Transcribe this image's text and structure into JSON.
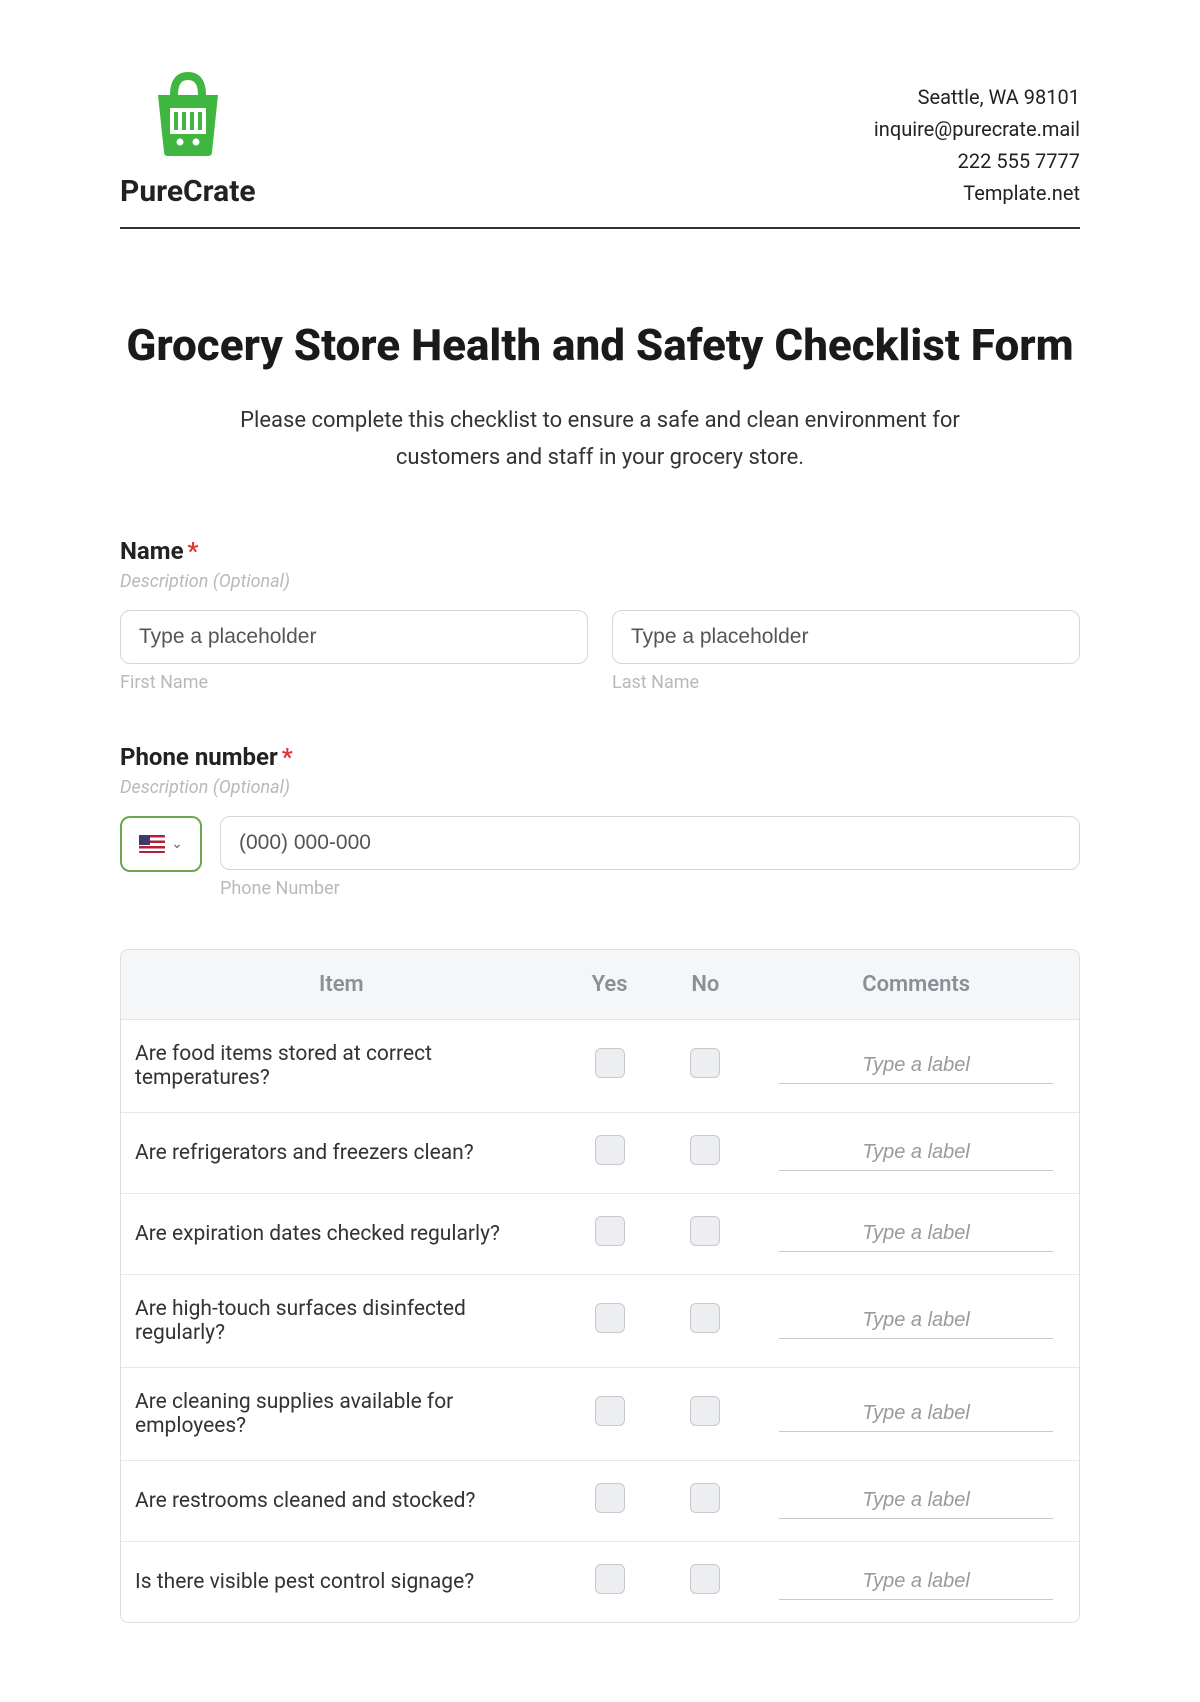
{
  "header": {
    "brand_name": "PureCrate",
    "contact": {
      "line1": "Seattle, WA 98101",
      "line2": "inquire@purecrate.mail",
      "line3": "222 555 7777",
      "line4": "Template.net"
    }
  },
  "form": {
    "title": "Grocery Store Health and Safety Checklist Form",
    "intro": "Please complete this checklist to ensure a safe and clean environment for customers and staff in your grocery store.",
    "name_section": {
      "label": "Name",
      "required_mark": "*",
      "description": "Description (Optional)",
      "first_placeholder": "Type a placeholder",
      "last_placeholder": "Type a placeholder",
      "first_sub": "First Name",
      "last_sub": "Last Name"
    },
    "phone_section": {
      "label": "Phone number",
      "required_mark": "*",
      "description": "Description (Optional)",
      "placeholder": "(000) 000-000",
      "sub": "Phone Number"
    },
    "table": {
      "headers": {
        "item": "Item",
        "yes": "Yes",
        "no": "No",
        "comments": "Comments"
      },
      "comment_placeholder": "Type a label",
      "rows": [
        {
          "item": "Are food items stored at correct temperatures?"
        },
        {
          "item": "Are refrigerators and freezers clean?"
        },
        {
          "item": "Are expiration dates checked regularly?"
        },
        {
          "item": "Are high-touch surfaces disinfected regularly?"
        },
        {
          "item": "Are cleaning supplies available for employees?"
        },
        {
          "item": "Are restrooms cleaned and stocked?"
        },
        {
          "item": "Is there visible pest control signage?"
        }
      ]
    }
  }
}
